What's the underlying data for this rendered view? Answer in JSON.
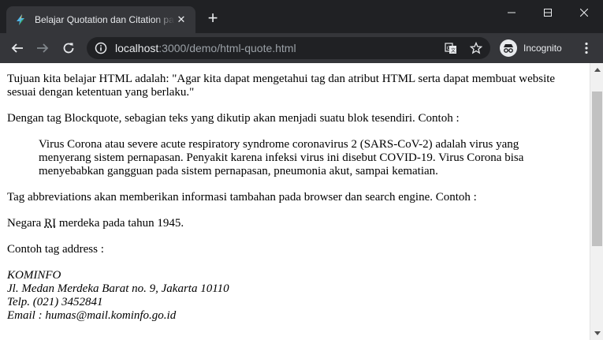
{
  "browser": {
    "tab_title": "Belajar Quotation dan Citation pada HTML",
    "url_host": "localhost",
    "url_path": ":3000/demo/html-quote.html",
    "incognito_label": "Incognito"
  },
  "page": {
    "intro": "Tujuan kita belajar HTML adalah: \"Agar kita dapat mengetahui tag dan atribut HTML serta dapat membuat website sesuai dengan ketentuan yang berlaku.\"",
    "blockquote_intro": "Dengan tag Blockquote, sebagian teks yang dikutip akan menjadi suatu blok tesendiri. Contoh :",
    "blockquote_text": "Virus Corona atau severe acute respiratory syndrome coronavirus 2 (SARS-CoV-2) adalah virus yang menyerang sistem pernapasan. Penyakit karena infeksi virus ini disebut COVID-19. Virus Corona bisa menyebabkan gangguan pada sistem pernapasan, pneumonia akut, sampai kematian.",
    "abbr_intro": "Tag abbreviations akan memberikan informasi tambahan pada browser dan search engine. Contoh :",
    "abbr_before": "Negara ",
    "abbr": "RI",
    "abbr_after": " merdeka pada tahun 1945.",
    "address_intro": "Contoh tag address :",
    "address": {
      "line1": "KOMINFO",
      "line2": "Jl. Medan Merdeka Barat no. 9, Jakarta 10110",
      "line3": "Telp. (021) 3452841",
      "line4": "Email : humas@mail.kominfo.go.id"
    }
  }
}
